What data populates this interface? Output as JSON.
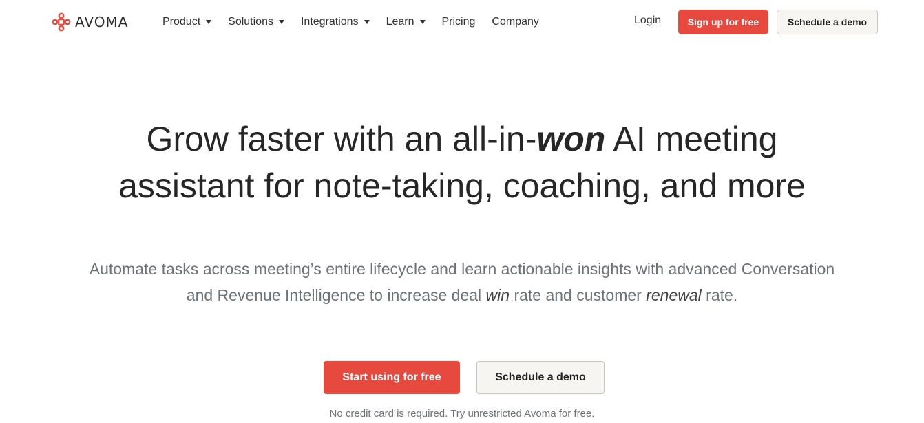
{
  "brand": {
    "name": "AVOMA",
    "logo_icon": "avoma-logo-icon",
    "accent_color": "#e8493f"
  },
  "nav": {
    "items": [
      {
        "label": "Product",
        "has_dropdown": true
      },
      {
        "label": "Solutions",
        "has_dropdown": true
      },
      {
        "label": "Integrations",
        "has_dropdown": true
      },
      {
        "label": "Learn",
        "has_dropdown": true
      },
      {
        "label": "Pricing",
        "has_dropdown": false
      },
      {
        "label": "Company",
        "has_dropdown": false
      }
    ],
    "login_label": "Login",
    "signup_label": "Sign up for free",
    "demo_label": "Schedule a demo"
  },
  "hero": {
    "title_part1": "Grow faster with an all-in-",
    "title_emphasis": "won",
    "title_part2": " AI meeting",
    "title_line2": "assistant for note-taking, coaching, and more",
    "subtitle_part1": "Automate tasks across meeting’s entire lifecycle and learn actionable insights with advanced Conversation",
    "subtitle_part2": "and Revenue Intelligence to increase deal ",
    "subtitle_em1": "win",
    "subtitle_part3": " rate and customer ",
    "subtitle_em2": "renewal",
    "subtitle_part4": " rate.",
    "cta_primary_label": "Start using for free",
    "cta_secondary_label": "Schedule a demo",
    "note": "No credit card is required. Try unrestricted Avoma for free."
  }
}
